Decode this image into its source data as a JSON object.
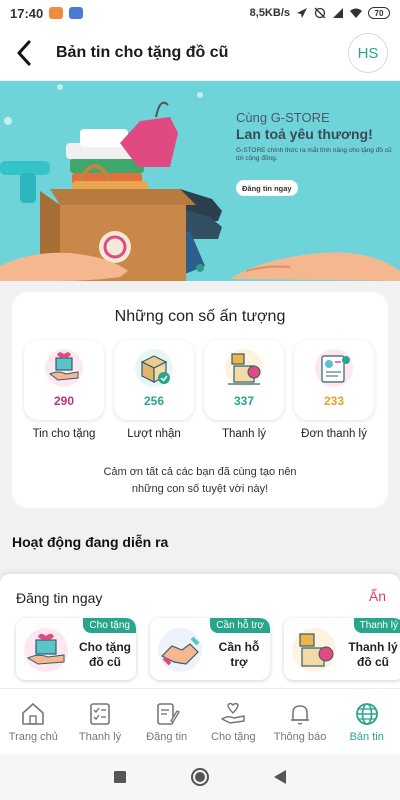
{
  "status_bar": {
    "time": "17:40",
    "speed": "8,5KB/s",
    "battery": "70"
  },
  "header": {
    "title": "Bản tin cho tặng đồ cũ",
    "avatar": "HS"
  },
  "banner": {
    "headline_1": "Cùng G-STORE",
    "headline_2": "Lan toả yêu thương!",
    "subtext": "G-STORE chính thức ra mắt tính năng cho tặng đồ cũ tới cộng đồng.",
    "cta": "Đăng tin ngay",
    "colors": {
      "bg": "#6fd4d9",
      "accent": "#2a9f8a"
    }
  },
  "stats": {
    "title": "Những con số ấn tượng",
    "items": [
      {
        "value": "290",
        "label": "Tin cho tặng",
        "color": "#c0317a",
        "icon": "gift-hand-icon"
      },
      {
        "value": "256",
        "label": "Lượt nhận",
        "color": "#2aa58d",
        "icon": "box-received-icon"
      },
      {
        "value": "337",
        "label": "Thanh lý",
        "color": "#2aa58d",
        "icon": "liquidation-box-icon"
      },
      {
        "value": "233",
        "label": "Đơn thanh lý",
        "color": "#e3a22a",
        "icon": "order-document-icon"
      }
    ],
    "thanks_1": "Cảm ơn tất cả các bạn đã cùng tạo nên",
    "thanks_2": "những con số tuyệt vời này!"
  },
  "activity": {
    "title": "Hoạt động đang diễn ra"
  },
  "sheet": {
    "title": "Đăng tin ngay",
    "hide": "Ẩn",
    "cards": [
      {
        "tag": "Cho tặng",
        "text_1": "Cho tặng",
        "text_2": "đồ cũ",
        "icon": "gift-hand-icon"
      },
      {
        "tag": "Cần hỗ trợ",
        "text_1": "Cần hỗ",
        "text_2": "trợ",
        "icon": "handshake-icon"
      },
      {
        "tag": "Thanh lý",
        "text_1": "Thanh lý",
        "text_2": "đồ cũ",
        "icon": "liquidation-box-icon"
      }
    ]
  },
  "tabs": [
    {
      "label": "Trang chủ",
      "icon": "home-icon"
    },
    {
      "label": "Thanh lý",
      "icon": "checklist-icon"
    },
    {
      "label": "Đăng tin",
      "icon": "edit-note-icon"
    },
    {
      "label": "Cho tặng",
      "icon": "hand-heart-icon"
    },
    {
      "label": "Thông báo",
      "icon": "bell-icon"
    },
    {
      "label": "Bản tin",
      "icon": "globe-icon",
      "active": true
    }
  ],
  "theme": {
    "primary": "#2aa58d",
    "danger": "#e33b62"
  }
}
